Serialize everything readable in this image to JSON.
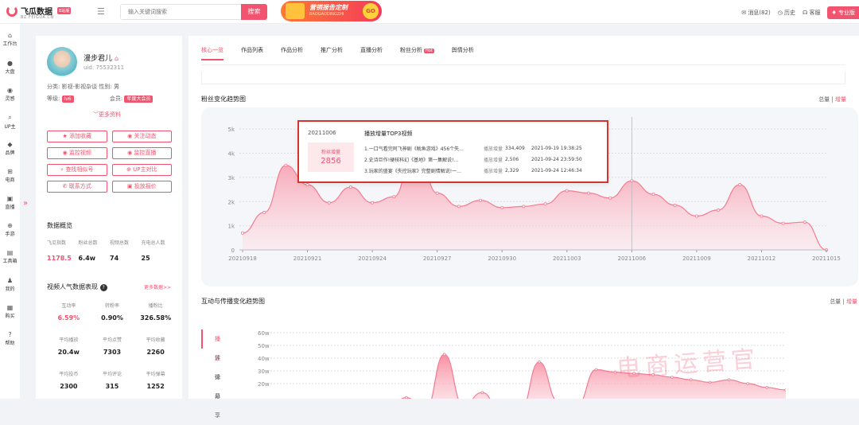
{
  "header": {
    "brand": "飞瓜数据",
    "brand_domain": "BZ.FEIGUA.CN",
    "brand_badge": "B站版",
    "search_placeholder": "输入关键词搜索",
    "search_button": "搜索",
    "promo_title": "营销报告定制",
    "promo_sub": "BAOGAODINGZHI",
    "promo_go": "GO",
    "messages": "消息(82)",
    "history": "历史",
    "service": "客服",
    "pro": "专业版"
  },
  "nav": [
    {
      "label": "工作台",
      "icon": "home-icon",
      "glyph": "⌂"
    },
    {
      "label": "大盘",
      "icon": "pie-icon",
      "glyph": "●"
    },
    {
      "label": "灵感",
      "icon": "bulb-icon",
      "glyph": "◉"
    },
    {
      "label": "UP主",
      "icon": "search-icon",
      "glyph": "⌕"
    },
    {
      "label": "品牌",
      "icon": "diamond-icon",
      "glyph": "◆"
    },
    {
      "label": "电商",
      "icon": "cart-icon",
      "glyph": "⊞"
    },
    {
      "label": "直播",
      "icon": "tv-icon",
      "glyph": "▣"
    },
    {
      "label": "手游",
      "icon": "gamepad-icon",
      "glyph": "⊕"
    },
    {
      "label": "工具箱",
      "icon": "toolbox-icon",
      "glyph": "▤"
    },
    {
      "label": "我的",
      "icon": "user-icon",
      "glyph": "♟"
    },
    {
      "label": "购买",
      "icon": "purchase-icon",
      "glyph": "▦"
    },
    {
      "label": "帮助",
      "icon": "help-icon",
      "glyph": "?"
    }
  ],
  "profile": {
    "name": "漫步君儿",
    "uid": "uid: 75532311",
    "category_label": "分类:",
    "category": "影视-影视杂谈",
    "gender_label": "性别:",
    "gender": "男",
    "level_label": "等级:",
    "level": "lv6",
    "member_label": "会员:",
    "member": "年度大会员",
    "more": "更多资料",
    "actions": [
      "添加收藏",
      "关注动态",
      "监控视频",
      "监控直播",
      "查找相似号",
      "UP主对比",
      "联系方式",
      "投放报价"
    ],
    "overview_title": "数据概览",
    "overview": [
      {
        "label": "飞瓜指数",
        "value": "1178.5"
      },
      {
        "label": "粉丝总数",
        "value": "6.4w"
      },
      {
        "label": "视频总数",
        "value": "74"
      },
      {
        "label": "充电总人数",
        "value": "25"
      }
    ],
    "video_title": "视频人气数据表现",
    "more_data": "更多数据>>",
    "video_stats": [
      {
        "label": "互动率",
        "value": "6.59%"
      },
      {
        "label": "转粉率",
        "value": "0.90%"
      },
      {
        "label": "播粉比",
        "value": "326.58%"
      },
      {
        "label": "平均播放",
        "value": "20.4w"
      },
      {
        "label": "平均点赞",
        "value": "7303"
      },
      {
        "label": "平均收藏",
        "value": "2260"
      },
      {
        "label": "平均投币",
        "value": "2300"
      },
      {
        "label": "平均评论",
        "value": "315"
      },
      {
        "label": "平均弹幕",
        "value": "1252"
      }
    ]
  },
  "tabs": [
    "核心一览",
    "作品列表",
    "作品分析",
    "推广分析",
    "直播分析",
    "粉丝分析",
    "舆情分析"
  ],
  "hot_label": "Hot",
  "fans_chart_title": "粉丝变化趋势图",
  "toggle_total": "总量",
  "toggle_inc": "增量",
  "interact_chart_title": "互动与传播变化趋势图",
  "interact_tabs": [
    "播放",
    "评论",
    "弹幕",
    "分享"
  ],
  "tooltip": {
    "date": "20211006",
    "heading": "播放增量TOP3视频",
    "box_label": "粉丝增量",
    "box_value": "2856",
    "rows": [
      {
        "title": "1.一口气看完阿飞神剧《鱿鱼游戏》456个失...",
        "label": "播放增量",
        "value": "334,409",
        "date": "2021-09-19 19:38:25"
      },
      {
        "title": "2.史诗巨作!硬核科幻《基地》第一集解说!...",
        "label": "播放增量",
        "value": "2,506",
        "date": "2021-09-24 23:59:50"
      },
      {
        "title": "3.玩家的盛宴《失控玩家》完整剧情解说!一...",
        "label": "播放增量",
        "value": "2,329",
        "date": "2021-09-24 12:46:34"
      }
    ]
  },
  "watermark": "电商运营官",
  "colors": {
    "accent": "#f2546f",
    "tooltip_border": "#d9342b"
  },
  "chart_data": [
    {
      "type": "area",
      "title": "粉丝变化趋势图",
      "x": [
        "20210918",
        "20210919",
        "20210920",
        "20210921",
        "20210922",
        "20210923",
        "20210924",
        "20210925",
        "20210926",
        "20210927",
        "20210928",
        "20210929",
        "20210930",
        "20211001",
        "20211002",
        "20211003",
        "20211004",
        "20211005",
        "20211006",
        "20211007",
        "20211008",
        "20211009",
        "20211010",
        "20211011",
        "20211012",
        "20211013",
        "20211014",
        "20211015"
      ],
      "tick_labels": [
        "20210918",
        "20210921",
        "20210924",
        "20210927",
        "20210930",
        "20211003",
        "20211006",
        "20211009",
        "20211012",
        "20211015"
      ],
      "y_ticks": [
        "0",
        "1k",
        "2k",
        "3k",
        "4k",
        "5k"
      ],
      "values": [
        700,
        1550,
        3500,
        2700,
        1950,
        2600,
        1950,
        2200,
        4500,
        2350,
        1800,
        2050,
        1750,
        1800,
        1900,
        2450,
        2350,
        2150,
        2856,
        2300,
        1850,
        1400,
        1650,
        2700,
        1400,
        1100,
        1150,
        0
      ],
      "ylim": [
        0,
        5500
      ]
    },
    {
      "type": "area",
      "title": "互动与传播变化趋势图",
      "y_ticks": [
        "20w",
        "30w",
        "40w",
        "50w",
        "60w"
      ],
      "values": [
        3,
        6,
        10,
        5,
        9,
        7,
        5,
        14,
        4,
        48,
        8,
        18,
        2,
        3,
        42,
        11,
        8,
        36,
        34,
        33,
        32,
        30,
        28,
        26,
        28,
        25,
        22,
        20
      ],
      "ylim": [
        0,
        65
      ]
    }
  ]
}
